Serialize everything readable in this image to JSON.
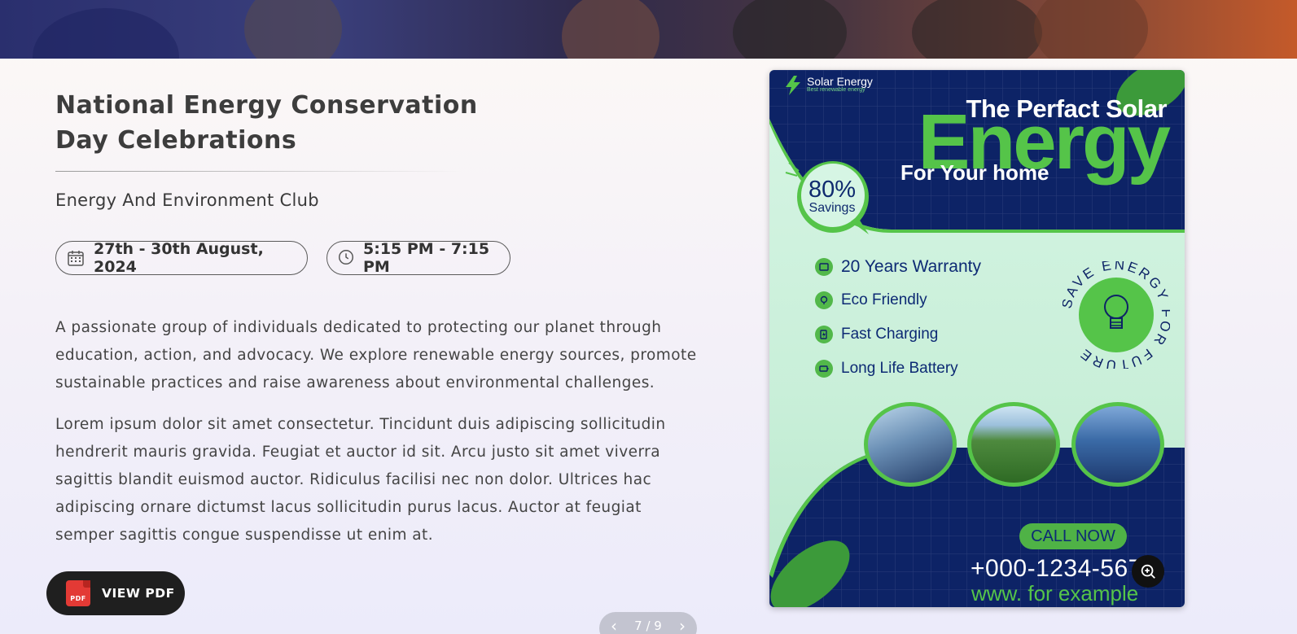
{
  "event": {
    "title": "National Energy Conservation Day Celebrations",
    "club": "Energy And Environment Club",
    "date": "27th - 30th August, 2024",
    "time": "5:15 PM - 7:15 PM",
    "paragraph1": "A passionate group of individuals dedicated to protecting our planet through education, action, and advocacy. We explore renewable energy sources, promote sustainable practices and raise awareness about environmental challenges.",
    "paragraph2": "Lorem ipsum dolor sit amet consectetur. Tincidunt duis adipiscing sollicitudin hendrerit mauris gravida. Feugiat et auctor id sit. Arcu justo sit amet viverra sagittis blandit euismod auctor. Ridiculus facilisi nec non dolor. Ultrices hac adipiscing ornare dictumst lacus sollicitudin purus lacus. Auctor at feugiat semper sagittis congue suspendisse ut enim at."
  },
  "pdf_button": {
    "icon_text": "PDF",
    "label": "VIEW PDF"
  },
  "pager": {
    "text": "7 / 9"
  },
  "poster": {
    "brand_name": "Solar Energy",
    "brand_tagline": "Best renewable energy",
    "headline_top": "The Perfact Solar",
    "headline_main": "Energy",
    "headline_bottom": "For Your home",
    "savings_percent": "80%",
    "savings_label": "Savings",
    "features": [
      "20 Years Warranty",
      "Eco Friendly",
      "Fast Charging",
      "Long Life Battery"
    ],
    "badge_text": "SAVE ENERGY FOR FUTURE",
    "cta": "CALL NOW",
    "phone": "+000-1234-5678",
    "website": "www. for example"
  },
  "colors": {
    "poster_navy": "#0d2366",
    "poster_green": "#55c449",
    "button_dark": "#1f1f1f",
    "pdf_red": "#e33a35"
  },
  "icons": [
    "calendar-icon",
    "clock-icon",
    "pdf-icon",
    "zoom-in-icon",
    "chevron-left-icon",
    "chevron-right-icon",
    "lightning-icon",
    "lightbulb-icon"
  ]
}
